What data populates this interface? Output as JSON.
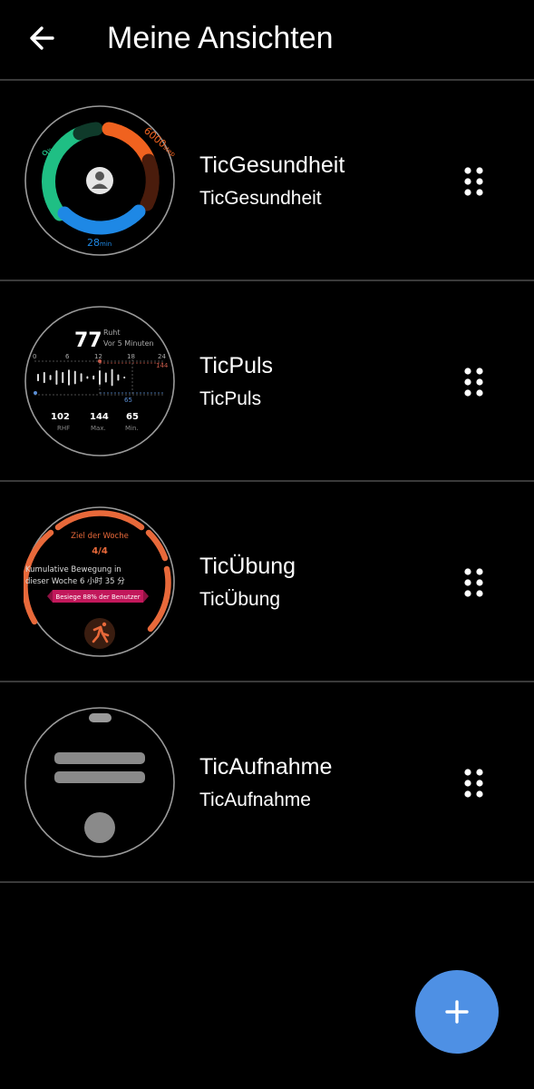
{
  "header": {
    "title": "Meine Ansichten"
  },
  "icons": {
    "back": "arrow-left-icon",
    "drag": "drag-handle-icon",
    "add": "plus-icon",
    "avatar": "user-avatar-icon",
    "run": "running-person-icon"
  },
  "colors": {
    "background": "#000000",
    "divider": "#3a3a3a",
    "fab": "#4e90e4",
    "health_green": "#1fbf84",
    "health_orange": "#f0621f",
    "health_blue": "#1e88e5",
    "exercise_orange": "#e8693a",
    "exercise_badge": "#c2185b"
  },
  "views": [
    {
      "title": "TicGesundheit",
      "subtitle": "TicGesundheit",
      "preview": {
        "hours": "9",
        "hours_unit": "h",
        "steps": "6000",
        "steps_unit": "step",
        "minutes": "28",
        "minutes_unit": "min"
      }
    },
    {
      "title": "TicPuls",
      "subtitle": "TicPuls",
      "preview": {
        "bpm": "77",
        "state": "Ruht",
        "time_ago": "Vor 5 Minuten",
        "axis": [
          "0",
          "6",
          "12",
          "18",
          "24"
        ],
        "high": "144",
        "low": "65",
        "stats": [
          {
            "value": "102",
            "label": "RHF"
          },
          {
            "value": "144",
            "label": "Max."
          },
          {
            "value": "65",
            "label": "Min."
          }
        ],
        "bar_levels": [
          0.55,
          0.7,
          0.45,
          0.85,
          0.7,
          0.9,
          0.8,
          0.6,
          0.35,
          0.4,
          0.85,
          0.65,
          0.95,
          0.5,
          0.3
        ]
      }
    },
    {
      "title": "TicÜbung",
      "subtitle": "TicÜbung",
      "preview": {
        "goal_title": "Ziel der Woche",
        "goal_value": "4/4",
        "line1": "Kumulative Bewegung in",
        "line2": "dieser Woche 6 小时 35 分",
        "badge": "Besiege 88% der Benutzer"
      }
    },
    {
      "title": "TicAufnahme",
      "subtitle": "TicAufnahme",
      "preview": {}
    }
  ],
  "fab": {
    "label": "+"
  }
}
